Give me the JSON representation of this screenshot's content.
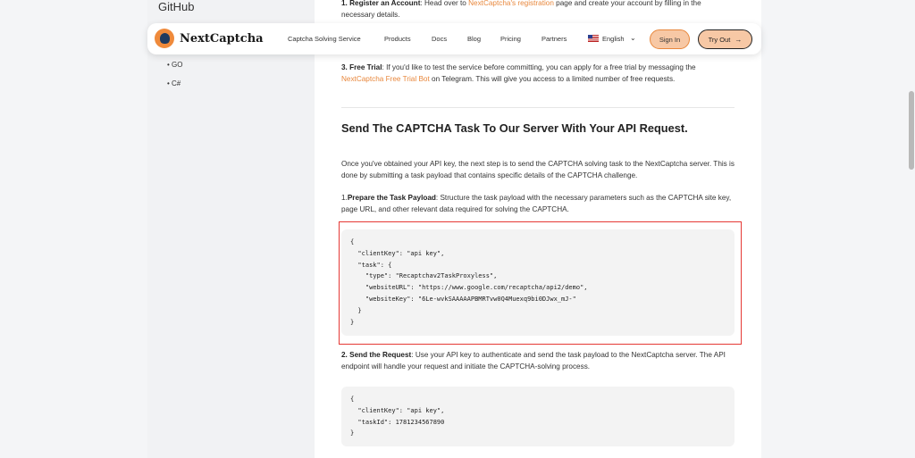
{
  "sidebar": {
    "title": "GitHub",
    "items": [
      {
        "label": "• GO"
      },
      {
        "label": "• C#"
      }
    ]
  },
  "navbar": {
    "logo_text": "NextCaptcha",
    "items": [
      "Captcha Solving Service",
      "Products",
      "Docs",
      "Blog",
      "Pricing",
      "Partners"
    ],
    "language": "English",
    "signin_label": "Sign In",
    "tryout_label": "Try Out"
  },
  "content": {
    "step1_bold": "1. Register an Account",
    "step1_text_a": ": Head over to ",
    "step1_link": "NextCaptcha's registration",
    "step1_text_b": " page and create your account by filling in the necessary details.",
    "step3_bold": "3. Free Trial",
    "step3_text_a": ": If you'd like to test the service before committing, you can apply for a free trial by messaging the ",
    "step3_link": "NextCaptcha Free Trial Bot",
    "step3_text_b": " on Telegram. This will give you access to a limited number of free requests.",
    "heading": "Send The CAPTCHA Task To Our Server With Your API Request.",
    "intro": "Once you've obtained your API key, the next step is to send the CAPTCHA solving task to the NextCaptcha server. This is done by submitting a task payload that contains specific details of the CAPTCHA challenge.",
    "prepare_prefix": "1.",
    "prepare_bold": "Prepare the Task Payload",
    "prepare_text": ": Structure the task payload with the necessary parameters such as the CAPTCHA site key, page URL, and other relevant data required for solving the CAPTCHA.",
    "code1": "{\n  \"clientKey\": \"api key\",\n  \"task\": {\n    \"type\": \"Recaptchav2TaskProxyless\",\n    \"websiteURL\": \"https://www.google.com/recaptcha/api2/demo\",\n    \"websiteKey\": \"6Le-wvkSAAAAAPBMRTvw0Q4Muexq9bi0DJwx_mJ-\"\n  }\n}",
    "send_bold": "2. Send the Request",
    "send_text": ": Use your API key to authenticate and send the task payload to the NextCaptcha server. The API endpoint will handle your request and initiate the CAPTCHA-solving process.",
    "code2": "{\n  \"clientKey\": \"api key\",\n  \"taskId\": 1781234567890\n}"
  },
  "colors": {
    "accent": "#e8873c",
    "highlight_border": "#e53935"
  }
}
